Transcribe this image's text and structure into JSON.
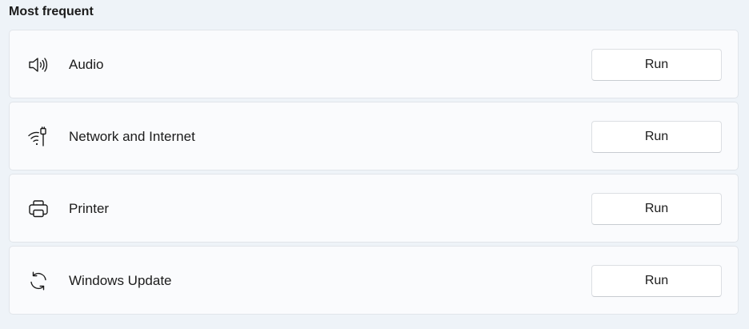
{
  "section": {
    "title": "Most frequent"
  },
  "troubleshooters": [
    {
      "label": "Audio",
      "icon": "speaker-icon",
      "button_label": "Run"
    },
    {
      "label": "Network and Internet",
      "icon": "network-icon",
      "button_label": "Run"
    },
    {
      "label": "Printer",
      "icon": "printer-icon",
      "button_label": "Run"
    },
    {
      "label": "Windows Update",
      "icon": "sync-icon",
      "button_label": "Run"
    }
  ]
}
